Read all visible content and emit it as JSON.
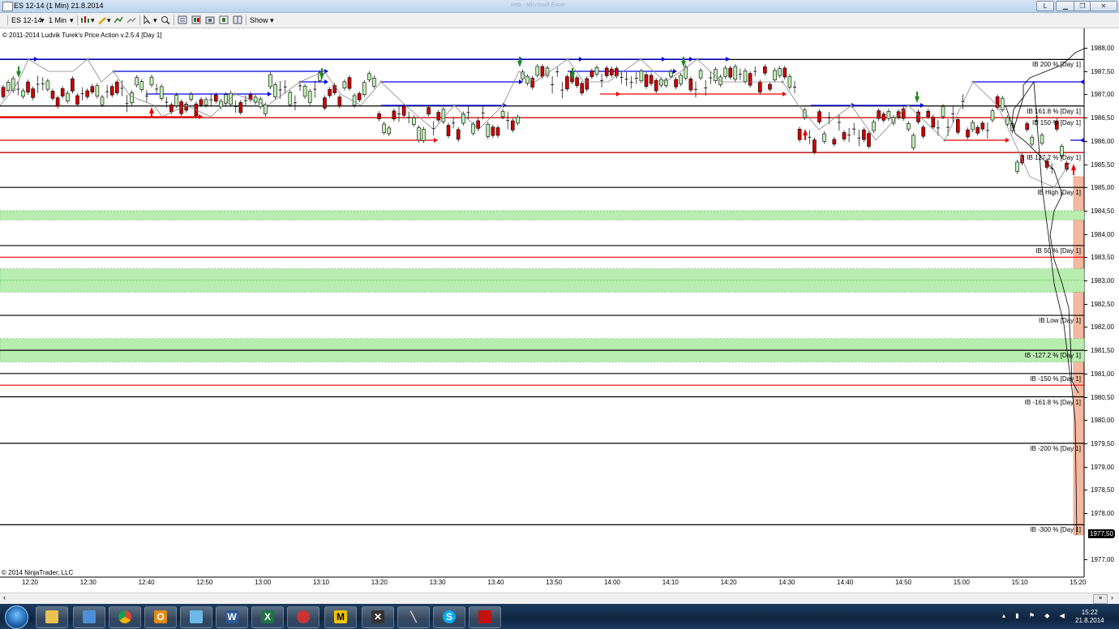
{
  "window": {
    "title": "ES 12-14 (1 Min)  21.8.2014",
    "faded_title": "web  -  Microsoft Excel"
  },
  "window_controls": {
    "left_button": "L"
  },
  "toolbar": {
    "instrument": "ES 12-14",
    "interval": "1 Min",
    "show_label": "Show"
  },
  "chart": {
    "copyright": "© 2011-2014 Ludvik Turek's Price Action v.2.5.4 [Day 1]",
    "platform_copyright": "© 2014 NinjaTrader, LLC",
    "last_price": "1977,50",
    "price_ticks": [
      "1988,00",
      "1987,50",
      "1987,00",
      "1986,50",
      "1986,00",
      "1985,50",
      "1985,00",
      "1984,50",
      "1984,00",
      "1983,50",
      "1983,00",
      "1982,50",
      "1982,00",
      "1981,50",
      "1981,00",
      "1980,50",
      "1980,00",
      "1979,50",
      "1979,00",
      "1978,50",
      "1978,00",
      "1977,00"
    ],
    "time_ticks": [
      "12:20",
      "12:30",
      "12:40",
      "12:50",
      "13:00",
      "13:10",
      "13:20",
      "13:30",
      "13:40",
      "13:50",
      "14:00",
      "14:10",
      "14:20",
      "14:30",
      "14:40",
      "14:50",
      "15:00",
      "15:10",
      "15:20"
    ],
    "ib_levels": [
      {
        "label": "IB 200 % [Day 1]",
        "price": 1987.75
      },
      {
        "label": "IB 161.8 % [Day 1]",
        "price": 1986.75
      },
      {
        "label": "IB 150 % [Day 1]",
        "price": 1986.5
      },
      {
        "label": "IB 127.2 % [Day 1]",
        "price": 1985.75
      },
      {
        "label": "IB High [Day 1]",
        "price": 1985.0
      },
      {
        "label": "IB 50 % [Day 1]",
        "price": 1983.75
      },
      {
        "label": "IB Low [Day 1]",
        "price": 1982.25
      },
      {
        "label": "IB -127.2 % [Day 1]",
        "price": 1981.5
      },
      {
        "label": "IB -150 % [Day 1]",
        "price": 1981.0
      },
      {
        "label": "IB -161.8 % [Day 1]",
        "price": 1980.5
      },
      {
        "label": "IB -200 % [Day 1]",
        "price": 1979.5
      },
      {
        "label": "IB -300 % [Day 1]",
        "price": 1977.75
      }
    ],
    "red_levels": [
      1985.75,
      1986.5,
      1983.5,
      1980.75
    ],
    "green_zones": [
      [
        1984.3,
        1984.5
      ],
      [
        1983.0,
        1983.25
      ],
      [
        1982.75,
        1983.0
      ],
      [
        1981.5,
        1981.75
      ],
      [
        1981.25,
        1981.5
      ]
    ]
  },
  "taskbar": {
    "apps": [
      "start-orb",
      "explorer",
      "notepad",
      "chrome",
      "outlook",
      "paint",
      "word",
      "excel",
      "ninjatrader",
      "m-app",
      "x-app",
      "pen-app",
      "skype",
      "acrobat"
    ],
    "clock_time": "15:22",
    "clock_date": "21.8.2014"
  }
}
